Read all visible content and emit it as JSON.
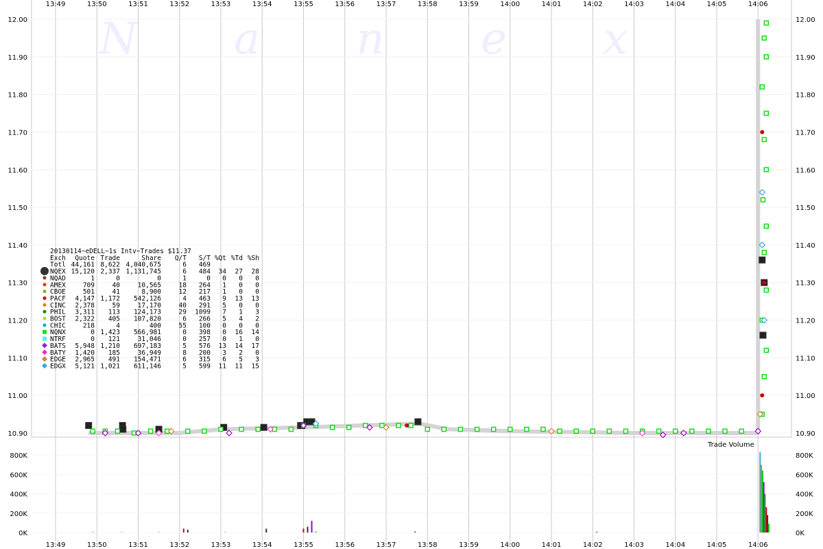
{
  "chart_data": [
    {
      "type": "scatter",
      "watermark": "N a n e x",
      "x": [
        "13:49",
        "13:50",
        "13:51",
        "13:52",
        "13:53",
        "13:54",
        "13:55",
        "13:56",
        "13:57",
        "13:58",
        "13:59",
        "14:00",
        "14:01",
        "14:02",
        "14:03",
        "14:04",
        "14:05",
        "14:06"
      ],
      "y_ticks": [
        "12.00",
        "11.90",
        "11.80",
        "11.70",
        "11.60",
        "11.50",
        "11.40",
        "11.30",
        "11.20",
        "11.10",
        "11.00",
        "10.90"
      ],
      "ylim": [
        10.9,
        12.0
      ],
      "grid": true,
      "series": [
        {
          "name": "NQEX",
          "color": "#333333",
          "marker": "square",
          "points": [
            [
              13.8,
              10.92
            ],
            [
              14.62,
              10.92
            ],
            [
              14.63,
              10.91
            ],
            [
              15.5,
              10.91
            ],
            [
              17.07,
              10.915
            ],
            [
              18.04,
              10.915
            ],
            [
              18.93,
              10.92
            ],
            [
              18.96,
              10.92
            ],
            [
              19.08,
              10.93
            ],
            [
              19.2,
              10.93
            ],
            [
              21.77,
              10.93
            ],
            [
              30.1,
              11.36
            ],
            [
              30.15,
              11.3
            ],
            [
              30.12,
              11.16
            ]
          ]
        },
        {
          "name": "NQNX",
          "color": "#00dd00",
          "marker": "square",
          "points": [
            [
              13.9,
              10.905
            ],
            [
              14.2,
              10.905
            ],
            [
              14.5,
              10.905
            ],
            [
              14.9,
              10.9
            ],
            [
              15.3,
              10.905
            ],
            [
              15.7,
              10.905
            ],
            [
              16.2,
              10.905
            ],
            [
              16.6,
              10.905
            ],
            [
              17.0,
              10.91
            ],
            [
              17.5,
              10.91
            ],
            [
              17.9,
              10.91
            ],
            [
              18.3,
              10.91
            ],
            [
              18.7,
              10.91
            ],
            [
              19.0,
              10.92
            ],
            [
              19.3,
              10.92
            ],
            [
              19.7,
              10.915
            ],
            [
              20.1,
              10.915
            ],
            [
              20.5,
              10.92
            ],
            [
              20.9,
              10.92
            ],
            [
              21.3,
              10.92
            ],
            [
              21.6,
              10.92
            ],
            [
              22.0,
              10.91
            ],
            [
              22.4,
              10.91
            ],
            [
              22.8,
              10.91
            ],
            [
              23.2,
              10.91
            ],
            [
              23.6,
              10.91
            ],
            [
              24.0,
              10.91
            ],
            [
              24.4,
              10.91
            ],
            [
              24.8,
              10.91
            ],
            [
              25.2,
              10.905
            ],
            [
              25.6,
              10.905
            ],
            [
              26.0,
              10.905
            ],
            [
              26.4,
              10.905
            ],
            [
              26.8,
              10.905
            ],
            [
              27.2,
              10.905
            ],
            [
              27.6,
              10.905
            ],
            [
              28.0,
              10.905
            ],
            [
              28.4,
              10.905
            ],
            [
              28.8,
              10.905
            ],
            [
              29.2,
              10.905
            ],
            [
              29.6,
              10.905
            ],
            [
              30.1,
              10.95
            ],
            [
              30.15,
              11.05
            ],
            [
              30.2,
              11.12
            ],
            [
              30.1,
              11.2
            ],
            [
              30.2,
              11.28
            ],
            [
              30.15,
              11.38
            ],
            [
              30.2,
              11.45
            ],
            [
              30.12,
              11.52
            ],
            [
              30.2,
              11.6
            ],
            [
              30.15,
              11.68
            ],
            [
              30.2,
              11.75
            ],
            [
              30.1,
              11.82
            ],
            [
              30.2,
              11.9
            ],
            [
              30.15,
              11.95
            ],
            [
              30.2,
              11.99
            ]
          ]
        },
        {
          "name": "BATS",
          "color": "#9900cc",
          "marker": "diamond",
          "points": [
            [
              14.2,
              10.9
            ],
            [
              15.0,
              10.9
            ],
            [
              17.2,
              10.9
            ],
            [
              19.0,
              10.92
            ],
            [
              20.6,
              10.915
            ],
            [
              27.7,
              10.895
            ],
            [
              28.2,
              10.9
            ],
            [
              30.0,
              10.905
            ]
          ]
        },
        {
          "name": "BATY",
          "color": "#ff44cc",
          "marker": "diamond",
          "points": [
            [
              15.5,
              10.9
            ],
            [
              18.2,
              10.91
            ],
            [
              27.2,
              10.9
            ]
          ]
        },
        {
          "name": "EDGE",
          "color": "#cc8833",
          "marker": "diamond",
          "points": [
            [
              15.8,
              10.905
            ],
            [
              21.0,
              10.915
            ],
            [
              25.0,
              10.905
            ],
            [
              30.05,
              10.95
            ]
          ]
        },
        {
          "name": "EDGX",
          "color": "#33aadd",
          "marker": "diamond",
          "points": [
            [
              19.3,
              10.925
            ],
            [
              30.1,
              11.4
            ],
            [
              30.1,
              11.54
            ],
            [
              30.15,
              11.2
            ]
          ]
        },
        {
          "name": "PACF",
          "color": "#cc0000",
          "marker": "circle",
          "points": [
            [
              21.5,
              10.92
            ],
            [
              30.1,
              11.0
            ],
            [
              30.15,
              11.3
            ],
            [
              30.1,
              11.7
            ]
          ]
        }
      ],
      "legend_title": "20130114~eDELL~1s Intv~Trades $11.37",
      "legend_columns": [
        "Exch",
        "Quote",
        "Trade",
        "Share",
        "Q/T",
        "S/T",
        "%Qt",
        "%Td",
        "%Sh"
      ],
      "legend_rows": [
        {
          "exch": "Totl",
          "quote": "44,161",
          "trade": "8,622",
          "share": "4,040,675",
          "qt": "6",
          "st": "469",
          "pqt": "",
          "ptd": "",
          "psh": "",
          "color": "",
          "marker": "none"
        },
        {
          "exch": "NQEX",
          "quote": "15,120",
          "trade": "2,337",
          "share": "1,131,745",
          "qt": "6",
          "st": "484",
          "pqt": "34",
          "ptd": "27",
          "psh": "28",
          "color": "#333333",
          "marker": "bigcircle"
        },
        {
          "exch": "NQAD",
          "quote": "1",
          "trade": "0",
          "share": "0",
          "qt": "1",
          "st": "0",
          "pqt": "0",
          "ptd": "0",
          "psh": "0",
          "color": "#993333",
          "marker": "circle"
        },
        {
          "exch": "AMEX",
          "quote": "709",
          "trade": "40",
          "share": "10,565",
          "qt": "18",
          "st": "264",
          "pqt": "1",
          "ptd": "0",
          "psh": "0",
          "color": "#cc4411",
          "marker": "circle"
        },
        {
          "exch": "CBOE",
          "quote": "501",
          "trade": "41",
          "share": "8,900",
          "qt": "12",
          "st": "217",
          "pqt": "1",
          "ptd": "0",
          "psh": "0",
          "color": "#88aa22",
          "marker": "circle"
        },
        {
          "exch": "PACF",
          "quote": "4,147",
          "trade": "1,172",
          "share": "542,126",
          "qt": "4",
          "st": "463",
          "pqt": "9",
          "ptd": "13",
          "psh": "13",
          "color": "#cc0000",
          "marker": "circle"
        },
        {
          "exch": "CINC",
          "quote": "2,378",
          "trade": "59",
          "share": "17,170",
          "qt": "40",
          "st": "291",
          "pqt": "5",
          "ptd": "0",
          "psh": "0",
          "color": "#dd8800",
          "marker": "circle"
        },
        {
          "exch": "PHIL",
          "quote": "3,311",
          "trade": "113",
          "share": "124,173",
          "qt": "29",
          "st": "1099",
          "pqt": "7",
          "ptd": "1",
          "psh": "3",
          "color": "#118811",
          "marker": "circle"
        },
        {
          "exch": "BOST",
          "quote": "2,322",
          "trade": "405",
          "share": "107,820",
          "qt": "6",
          "st": "266",
          "pqt": "5",
          "ptd": "4",
          "psh": "2",
          "color": "#aadd22",
          "marker": "circle"
        },
        {
          "exch": "CHIC",
          "quote": "218",
          "trade": "4",
          "share": "400",
          "qt": "55",
          "st": "100",
          "pqt": "0",
          "ptd": "0",
          "psh": "0",
          "color": "#11aacc",
          "marker": "circle"
        },
        {
          "exch": "NQNX",
          "quote": "0",
          "trade": "1,423",
          "share": "566,981",
          "qt": "0",
          "st": "398",
          "pqt": "0",
          "ptd": "16",
          "psh": "14",
          "color": "#22dd22",
          "marker": "square"
        },
        {
          "exch": "NTRF",
          "quote": "0",
          "trade": "121",
          "share": "31,046",
          "qt": "0",
          "st": "257",
          "pqt": "0",
          "ptd": "1",
          "psh": "0",
          "color": "#55eedd",
          "marker": "square"
        },
        {
          "exch": "BATS",
          "quote": "5,948",
          "trade": "1,210",
          "share": "697,183",
          "qt": "5",
          "st": "576",
          "pqt": "13",
          "ptd": "14",
          "psh": "17",
          "color": "#9922cc",
          "marker": "diamond"
        },
        {
          "exch": "BATY",
          "quote": "1,420",
          "trade": "185",
          "share": "36,949",
          "qt": "8",
          "st": "200",
          "pqt": "3",
          "ptd": "2",
          "psh": "0",
          "color": "#ee33bb",
          "marker": "diamond"
        },
        {
          "exch": "EDGE",
          "quote": "2,965",
          "trade": "491",
          "share": "154,471",
          "qt": "6",
          "st": "315",
          "pqt": "6",
          "ptd": "5",
          "psh": "3",
          "color": "#cc8833",
          "marker": "diamond"
        },
        {
          "exch": "EDGX",
          "quote": "5,121",
          "trade": "1,021",
          "share": "611,146",
          "qt": "5",
          "st": "599",
          "pqt": "11",
          "ptd": "11",
          "psh": "15",
          "color": "#33aadd",
          "marker": "diamond"
        }
      ]
    },
    {
      "type": "bar",
      "title": "Trade Volume",
      "y_ticks": [
        "800K",
        "600K",
        "400K",
        "200K",
        "0K"
      ],
      "ylim": [
        0,
        800000
      ],
      "x": [
        "13:49",
        "13:50",
        "13:51",
        "13:52",
        "13:53",
        "13:54",
        "13:55",
        "13:56",
        "13:57",
        "13:58",
        "13:59",
        "14:00",
        "14:01",
        "14:02",
        "14:03",
        "14:04",
        "14:05",
        "14:06"
      ],
      "bars": [
        {
          "t": 13.9,
          "v": 5000,
          "color": "#00cc00"
        },
        {
          "t": 14.6,
          "v": 4000,
          "color": "#00cc00"
        },
        {
          "t": 15.5,
          "v": 4000,
          "color": "#00cc00"
        },
        {
          "t": 16.1,
          "v": 40000,
          "color": "#cc0000"
        },
        {
          "t": 16.2,
          "v": 30000,
          "color": "#333333"
        },
        {
          "t": 17.1,
          "v": 4000,
          "color": "#00cc00"
        },
        {
          "t": 18.1,
          "v": 40000,
          "color": "#333333"
        },
        {
          "t": 19.0,
          "v": 40000,
          "color": "#cc0000"
        },
        {
          "t": 19.1,
          "v": 60000,
          "color": "#333333"
        },
        {
          "t": 19.2,
          "v": 120000,
          "color": "#9900cc"
        },
        {
          "t": 19.3,
          "v": 10000,
          "color": "#00cc00"
        },
        {
          "t": 21.7,
          "v": 10000,
          "color": "#333333"
        },
        {
          "t": 26.1,
          "v": 8000,
          "color": "#cc0000"
        },
        {
          "t": 30.05,
          "v": 830000,
          "color": "#33aadd"
        },
        {
          "t": 30.08,
          "v": 700000,
          "color": "#cc8833"
        },
        {
          "t": 30.11,
          "v": 640000,
          "color": "#00cc00"
        },
        {
          "t": 30.14,
          "v": 520000,
          "color": "#9900cc"
        },
        {
          "t": 30.17,
          "v": 400000,
          "color": "#00cc00"
        },
        {
          "t": 30.2,
          "v": 260000,
          "color": "#cc0000"
        },
        {
          "t": 30.23,
          "v": 180000,
          "color": "#333333"
        },
        {
          "t": 30.26,
          "v": 90000,
          "color": "#00cc00"
        }
      ]
    }
  ]
}
